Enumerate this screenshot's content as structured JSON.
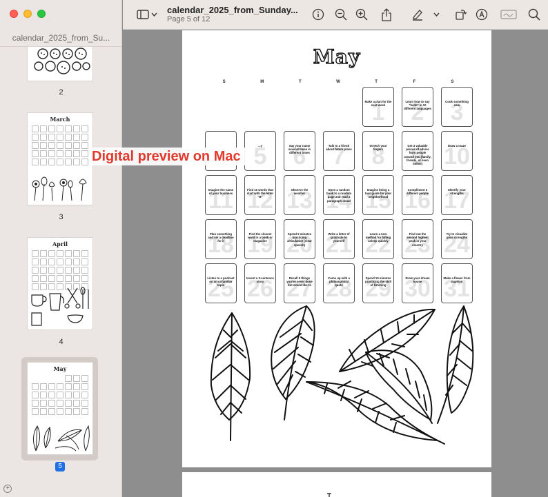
{
  "window": {
    "title": "calendar_2025_from_Sunday...",
    "subtitle": "Page 5 of 12"
  },
  "sidebar": {
    "title": "calendar_2025_from_Su...",
    "pages": [
      {
        "number": "2"
      },
      {
        "number": "3",
        "month": "March"
      },
      {
        "number": "4",
        "month": "April"
      },
      {
        "number": "5",
        "month": "May",
        "selected": true
      }
    ]
  },
  "toolbar": {
    "icons": [
      "sidebar-toggle-icon",
      "chevron-down-icon",
      "info-icon",
      "zoom-out-icon",
      "zoom-in-icon",
      "share-icon",
      "highlight-pen-icon",
      "chevron-down-icon",
      "rotate-icon",
      "markup-icon",
      "signature-icon",
      "search-icon"
    ]
  },
  "overlay": {
    "text": "Digital preview on Mac",
    "color": "#e2392c"
  },
  "calendar": {
    "month": "May",
    "weekdays": [
      "S",
      "M",
      "T",
      "W",
      "T",
      "F",
      "S"
    ],
    "leading_empty": 4,
    "days": [
      {
        "n": "1",
        "t": "Make a plan for the next week"
      },
      {
        "n": "2",
        "t": "Learn how to say \"hello\" in 10 different languages"
      },
      {
        "n": "3",
        "t": "Cook something new"
      },
      {
        "n": "4",
        "t": ""
      },
      {
        "n": "5",
        "t": "...y"
      },
      {
        "n": "6",
        "t": "Say your name several times in different tones"
      },
      {
        "n": "7",
        "t": "Talk to a friend about future plans"
      },
      {
        "n": "8",
        "t": "Stretch your fingers"
      },
      {
        "n": "9",
        "t": "Get 3 valuable pieces of advice from people around you (family, friends, or even online)"
      },
      {
        "n": "10",
        "t": "Draw a maze"
      },
      {
        "n": "11",
        "t": "Imagine the name of your business"
      },
      {
        "n": "12",
        "t": "Find 10 words that start with the letter \"B\""
      },
      {
        "n": "13",
        "t": "Observe the weather"
      },
      {
        "n": "14",
        "t": "Open a random book to a random page and read a paragraph aloud"
      },
      {
        "n": "15",
        "t": "Imagine being a tour guide for your neighborhood"
      },
      {
        "n": "16",
        "t": "Compliment 3 different people"
      },
      {
        "n": "17",
        "t": "Identify your strengths"
      },
      {
        "n": "18",
        "t": "Plan something and set a deadline for it"
      },
      {
        "n": "19",
        "t": "Find the closest word in a book or magazine"
      },
      {
        "n": "20",
        "t": "Spend 5 minutes practicing articulation (clear speech)"
      },
      {
        "n": "21",
        "t": "Write a letter of gratitude to yourself"
      },
      {
        "n": "22",
        "t": "Learn a new method for falling asleep quickly"
      },
      {
        "n": "23",
        "t": "Find out the second highest peak in your country"
      },
      {
        "n": "24",
        "t": "Try to visualize your strengths"
      },
      {
        "n": "25",
        "t": "Listen to a podcast on an unfamiliar topic"
      },
      {
        "n": "26",
        "t": "Invent a 3-sentence story"
      },
      {
        "n": "27",
        "t": "Recall 5 things you've never done but would like to"
      },
      {
        "n": "28",
        "t": "Come up with a philosophical quote"
      },
      {
        "n": "29",
        "t": "Spend 10 minutes practicing the skill of listening"
      },
      {
        "n": "30",
        "t": "Draw your dream house"
      },
      {
        "n": "31",
        "t": "Make a flower from napkins"
      }
    ]
  }
}
